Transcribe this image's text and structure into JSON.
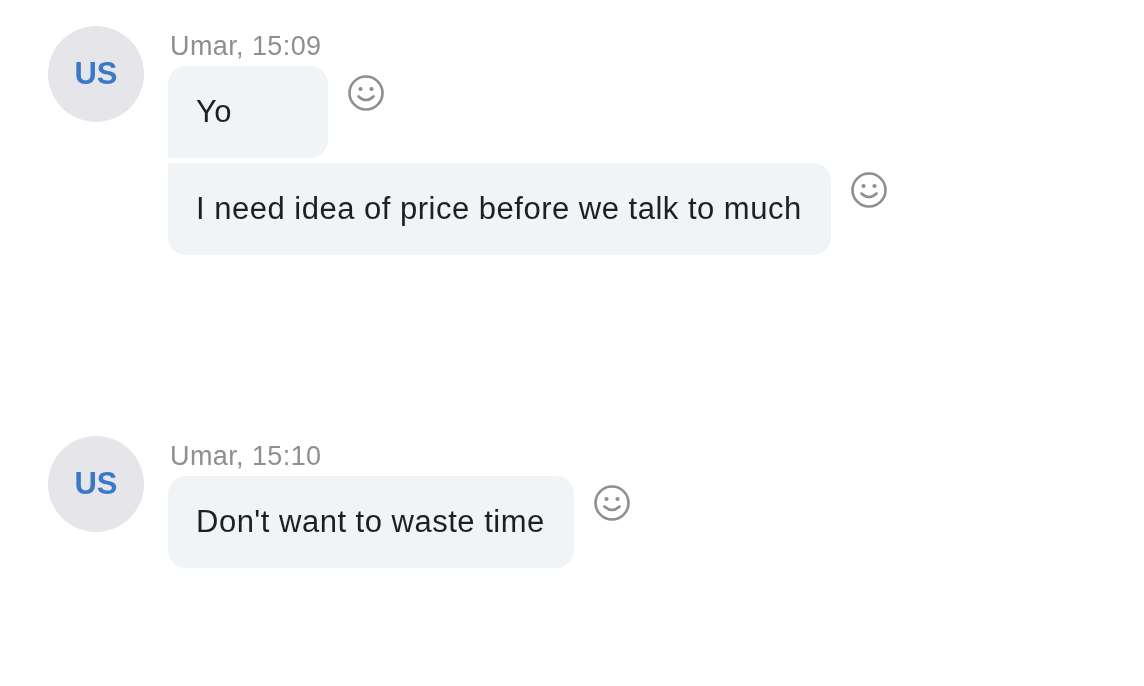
{
  "messages": [
    {
      "avatar": "US",
      "header": "Umar, 15:09",
      "bubbles": [
        "Yo",
        "I need idea of price before we talk to much"
      ]
    },
    {
      "avatar": "US",
      "header": "Umar, 15:10",
      "bubbles": [
        "Don't want to waste time"
      ]
    }
  ]
}
